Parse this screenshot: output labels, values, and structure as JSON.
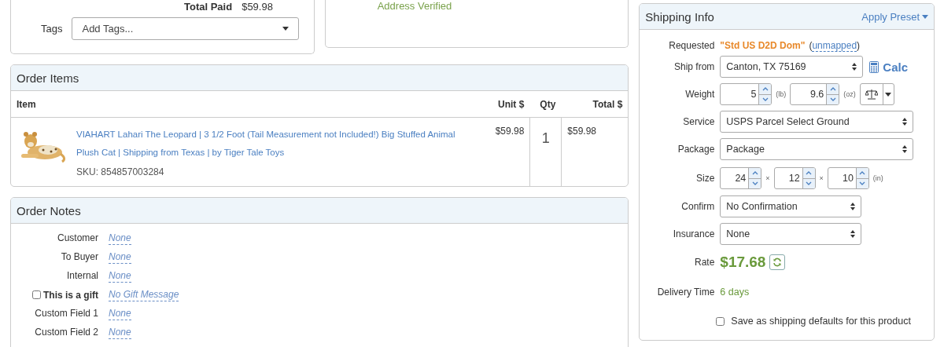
{
  "payment_summary": {
    "label": "Total Paid",
    "value": "$59.98"
  },
  "tags": {
    "label": "Tags",
    "placeholder": "Add Tags..."
  },
  "address": {
    "status": "Address Verified"
  },
  "order_items": {
    "title": "Order Items",
    "columns": [
      "Item",
      "Unit $",
      "Qty",
      "Total $"
    ],
    "rows": [
      {
        "name": "VIAHART Lahari The Leopard | 3 1/2 Foot (Tail Measurement not Included!) Big Stuffed Animal Plush Cat | Shipping from Texas | by Tiger Tale Toys",
        "sku": "SKU: 854857003284",
        "unit": "$59.98",
        "qty": "1",
        "total": "$59.98"
      }
    ]
  },
  "order_notes": {
    "title": "Order Notes",
    "fields": [
      {
        "kind": "note",
        "label": "Customer",
        "value": "None"
      },
      {
        "kind": "note",
        "label": "To Buyer",
        "value": "None"
      },
      {
        "kind": "note",
        "label": "Internal",
        "value": "None"
      },
      {
        "kind": "checkbox",
        "label": "This is a gift",
        "checked": false,
        "value": "No Gift Message"
      },
      {
        "kind": "note",
        "label": "Custom Field 1",
        "value": "None"
      },
      {
        "kind": "note",
        "label": "Custom Field 2",
        "value": "None"
      }
    ]
  },
  "shipping": {
    "title": "Shipping Info",
    "preset": "Apply Preset",
    "requested": {
      "label": "Requested",
      "value": "\"Std US D2D Dom\"",
      "before": "(",
      "link": "unmapped",
      "after": ")"
    },
    "ship_from": {
      "label": "Ship from",
      "value": "Canton, TX 75169",
      "calc": "Calc"
    },
    "weight": {
      "label": "Weight",
      "lb": "5",
      "lb_unit": "(lb)",
      "oz": "9.6",
      "oz_unit": "(oz)"
    },
    "service": {
      "label": "Service",
      "value": "USPS Parcel Select Ground"
    },
    "package": {
      "label": "Package",
      "value": "Package"
    },
    "size": {
      "label": "Size",
      "values": [
        "24",
        "12",
        "10"
      ],
      "separator": "×",
      "unit": "(in)"
    },
    "confirm": {
      "label": "Confirm",
      "value": "No Confirmation"
    },
    "insurance": {
      "label": "Insurance",
      "value": "None"
    },
    "rate": {
      "label": "Rate",
      "value": "$17.68"
    },
    "delivery": {
      "label": "Delivery Time",
      "value": "6 days"
    },
    "save_defaults": {
      "label": "Save as shipping defaults for this product",
      "checked": false
    }
  }
}
